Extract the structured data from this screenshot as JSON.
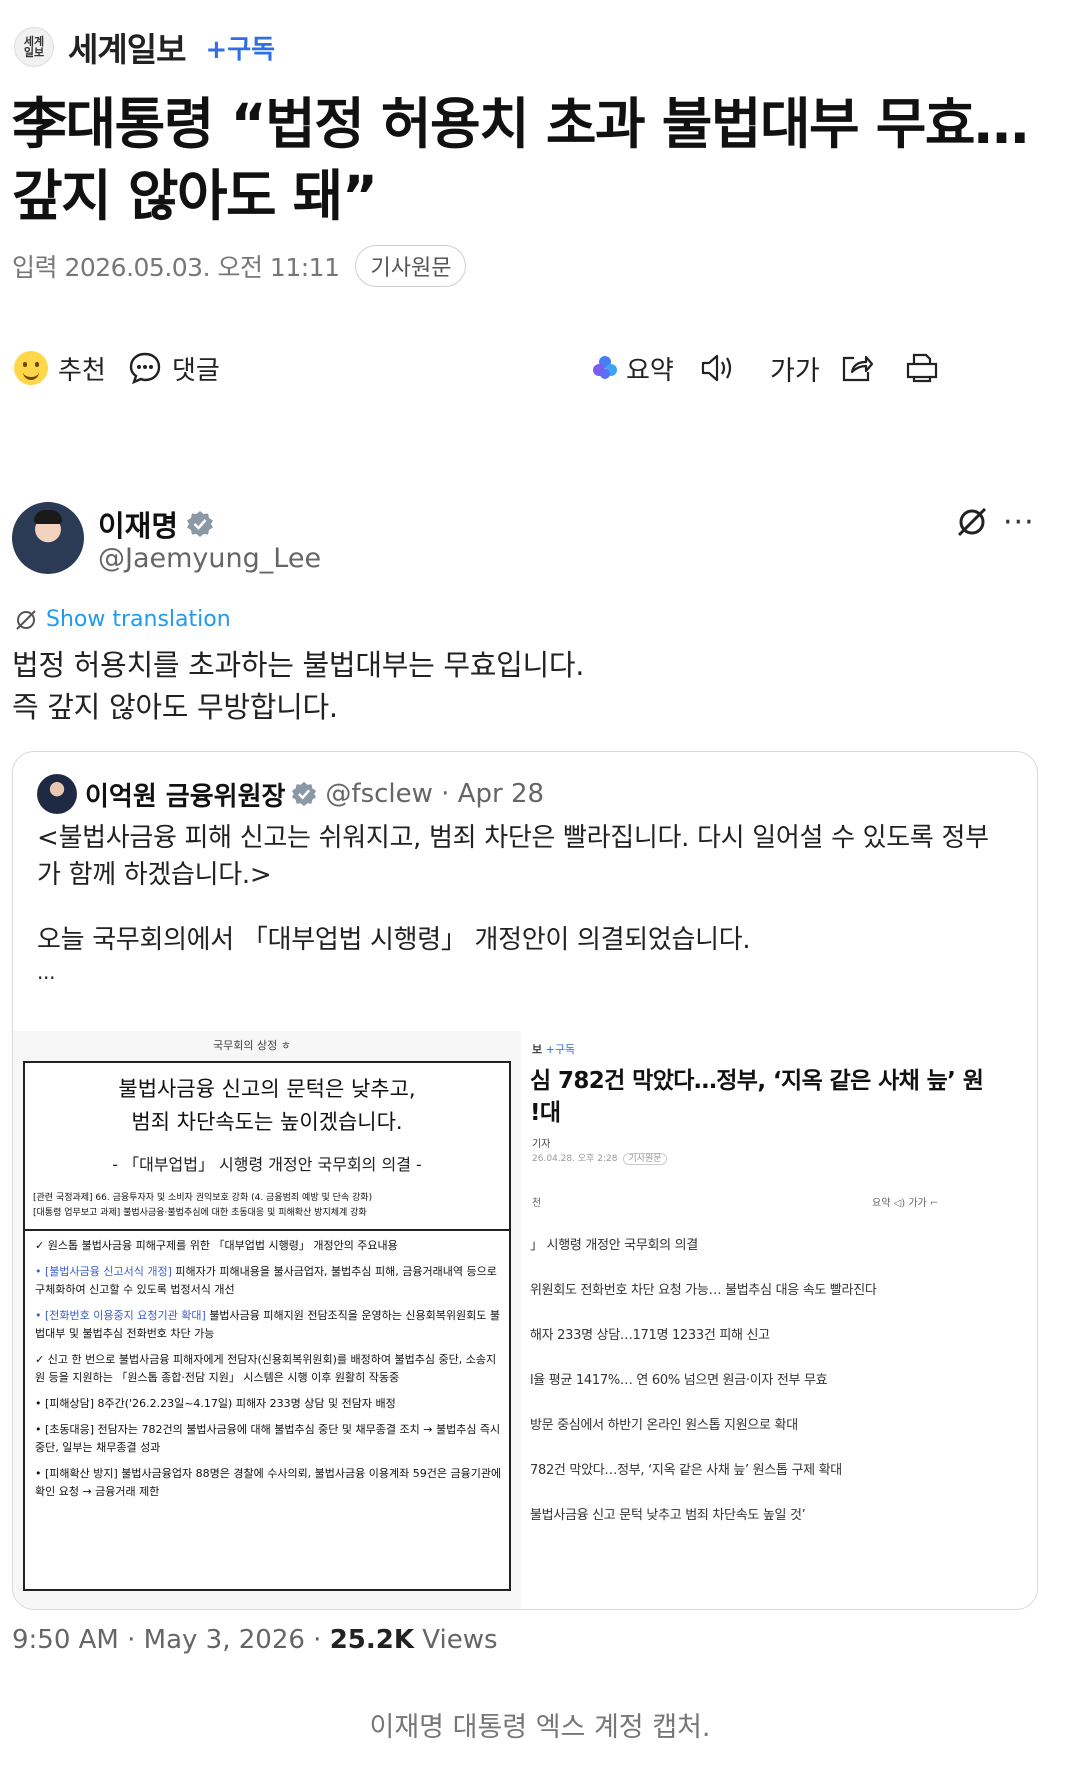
{
  "press": {
    "logo_text": "세계\n일보",
    "name": "세계일보",
    "subscribe": "+구독"
  },
  "article": {
    "headline_line1": "李대통령 “법정 허용치 초과 불법대부 무효…",
    "headline_line2": "갚지 않아도 돼”",
    "date": "입력 2026.05.03. 오전 11:11",
    "original_button": "기사원문"
  },
  "toolbar": {
    "recommend": "추천",
    "comment": "댓글",
    "summary": "요약",
    "font_size_label": "가가"
  },
  "tweet": {
    "author_name": "이재명",
    "author_handle": "@Jaemyung_Lee",
    "more": "···",
    "show_translation": "Show translation",
    "text_line1": "법정 허용치를 초과하는 불법대부는 무효입니다.",
    "text_line2": "즉 갚지 않아도 무방합니다.",
    "quote": {
      "author_name": "이억원 금융위원장",
      "handle_date": "@fsclew · Apr 28",
      "text_line1": "<불법사금융 피해 신고는 쉬워지고, 범죄 차단은 빨라집니다. 다시 일어설 수 있도록 정부",
      "text_line2": "가 함께 하겠습니다.>",
      "text_line3": "오늘 국무회의에서 「대부업법 시행령」 개정안이 의결되었습니다.",
      "ellipsis": "...",
      "doc": {
        "top_note": "국무회의 상정 ㅎ",
        "title_line1": "불법사금융 신고의 문턱은 낮추고,",
        "title_line2": "범죄 차단속도는 높이겠습니다.",
        "subtitle": "- 「대부업법」 시행령 개정안 국무회의 의결 -",
        "related_line1": "[관련 국정과제] 66. 금융투자자 및 소비자 권익보호 강화 (4. 금융범죄 예방 및 단속 강화)",
        "related_line2": "[대통령 업무보고 과제] 불법사금융·불법추심에 대한 초동대응 및 피해확산 방지체계 강화",
        "b1": "✓ 원스톱 불법사금융 피해구제를 위한 「대부업법 시행령」 개정안의 주요내용",
        "b2_blue": "• [불법사금융 신고서식 개정]",
        "b2_rest": " 피해자가 피해내용을 불사금업자, 불법추심 피해, 금융거래내역 등으로 구체화하여 신고할 수 있도록 법정서식 개선",
        "b3_blue": "• [전화번호 이용중지 요청기관 확대]",
        "b3_rest": " 불법사금융 피해지원 전담조직을 운영하는 신용회복위원회도 불법대부 및 불법추심 전화번호 차단 가능",
        "b4": "✓ 신고 한 번으로 불법사금융 피해자에게 전담자(신용회복위원회)를 배정하여 불법추심 중단, 소송지원 등을 지원하는 「원스톱 종합·전담 지원」 시스템은 시행 이후 원활히 작동중",
        "b5": "• [피해상담] 8주간('26.2.23일~4.17일) 피해자 233명 상담 및 전담자 배정",
        "b6": "• [초동대응] 전담자는 782건의 불법사금융에 대해 불법추심 중단 및 채무종결 조치 → 불법추심 즉시 중단, 일부는 채무종결 성과",
        "b7": "• [피해확산 방지] 불법사금융업자 88명은 경찰에 수사의뢰, 불법사금융 이용계좌 59건은 금융기관에 확인 요청 → 금융거래 제한"
      },
      "right_article": {
        "press": "보",
        "subscribe": "+구독",
        "title_line1": "심 782건 막았다…정부, ‘지옥 같은 사채 늪’ 원",
        "title_line2": "!대",
        "reporter": "기자",
        "date": "26.04.28. 오후 2:28",
        "orig": "기사원문",
        "tool_left": "천",
        "tool_right": "요약  ◁)  가가  ⌐",
        "items": [
          "」 시행령 개정안 국무회의 의결",
          "위원회도 전화번호 차단 요청 가능… 불법추심 대응 속도 빨라진다",
          "해자 233명 상담…171명 1233건 피해 신고",
          "l율 평균 1417%… 연 60% 넘으면 원금·이자 전부 무효",
          "방문 중심에서 하반기 온라인 원스톱 지원으로 확대",
          "782건 막았다…정부, ‘지옥 같은 사채 늪’ 원스톱 구제 확대",
          "불법사금융 신고 문턱 낮추고 범죄 차단속도 높일 것’"
        ]
      }
    },
    "footer_time": "9:50 AM · May 3, 2026 ·",
    "footer_views_count": "25.2K",
    "footer_views_label": "Views"
  },
  "caption": "이재명 대통령 엑스 계정 캡처.",
  "colors": {
    "accent_blue": "#2f6fe0",
    "link_blue": "#1d9bf0",
    "verified_gray": "#8b98a5"
  },
  "icons": [
    "smile-icon",
    "comment-icon",
    "summary-icon",
    "speaker-icon",
    "share-icon",
    "print-icon",
    "verified-icon",
    "grok-icon",
    "translate-icon"
  ]
}
